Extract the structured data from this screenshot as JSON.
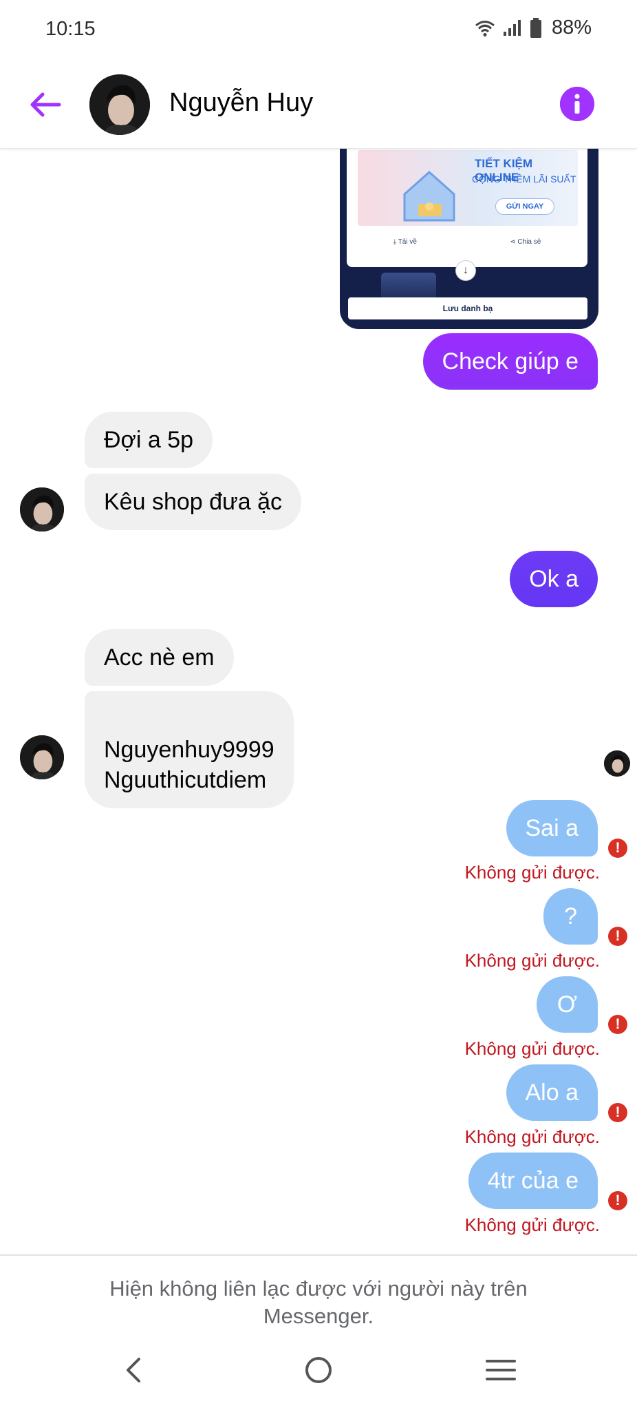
{
  "status_bar": {
    "time": "10:15",
    "battery": "88%",
    "icons": [
      "wifi-icon",
      "signal-icon",
      "battery-icon"
    ]
  },
  "header": {
    "contact_name": "Nguyễn Huy",
    "back_icon": "arrow-left-icon",
    "info_icon": "info-icon",
    "accent_color": "#a033ff"
  },
  "attachment": {
    "banner_title": "TIẾT KIỆM ONLINE",
    "banner_subtitle": "CỘNG THÊM LÃI SUẤT",
    "banner_button": "GỬI NGAY",
    "action_download": "Tải về",
    "action_share": "Chia sẻ",
    "save_contact": "Lưu danh bạ"
  },
  "messages": [
    {
      "sender": "me",
      "text": "Check giúp e",
      "status": "sent"
    },
    {
      "sender": "them",
      "text": "Đợi a 5p"
    },
    {
      "sender": "them",
      "text": "Kêu shop đưa ặc"
    },
    {
      "sender": "me",
      "text": "Ok a",
      "status": "sent"
    },
    {
      "sender": "them",
      "text": "Acc nè em"
    },
    {
      "sender": "them",
      "text": "Nguyenhuy9999\nNguuthicutdiem"
    },
    {
      "sender": "me",
      "text": "Sai a",
      "status": "failed"
    },
    {
      "sender": "me",
      "text": "?",
      "status": "failed"
    },
    {
      "sender": "me",
      "text": "Ơ",
      "status": "failed"
    },
    {
      "sender": "me",
      "text": "Alo a",
      "status": "failed"
    },
    {
      "sender": "me",
      "text": "4tr của e",
      "status": "failed"
    }
  ],
  "failed_label": "Không gửi được.",
  "notice": "Hiện không liên lạc được với người này trên Messenger.",
  "nav": {
    "back": "nav-back-icon",
    "home": "nav-home-icon",
    "recents": "nav-recents-icon"
  },
  "colors": {
    "out_gradient_start": "#a033ff",
    "out_gradient_end": "#6e3bf6",
    "failed_bubble": "#8ec2f7",
    "error_red": "#d93025"
  }
}
